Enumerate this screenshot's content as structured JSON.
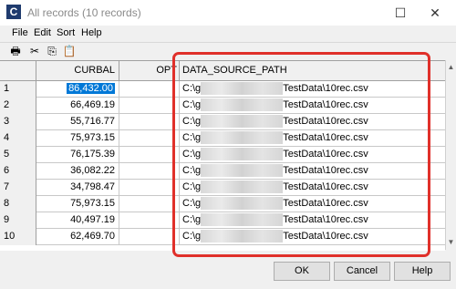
{
  "window": {
    "title": "All records (10 records)",
    "icon": "C",
    "max_glyph": "☐",
    "close_glyph": "✕"
  },
  "menu": {
    "file": "File",
    "edit": "Edit",
    "sort": "Sort",
    "help": "Help"
  },
  "toolbar": {
    "print": "🖶",
    "cut": "✂",
    "copy": "⎘",
    "paste": "📋"
  },
  "columns": {
    "curbal": "CURBAL",
    "opt": "OPT",
    "data_source_path": "DATA_SOURCE_PATH"
  },
  "rows": [
    {
      "num": "1",
      "curbal": "86,432.00",
      "path_prefix": "C:\\g",
      "path_suffix": "TestData\\10rec.csv"
    },
    {
      "num": "2",
      "curbal": "66,469.19",
      "path_prefix": "C:\\g",
      "path_suffix": "TestData\\10rec.csv"
    },
    {
      "num": "3",
      "curbal": "55,716.77",
      "path_prefix": "C:\\g",
      "path_suffix": "TestData\\10rec.csv"
    },
    {
      "num": "4",
      "curbal": "75,973.15",
      "path_prefix": "C:\\g",
      "path_suffix": "TestData\\10rec.csv"
    },
    {
      "num": "5",
      "curbal": "76,175.39",
      "path_prefix": "C:\\g",
      "path_suffix": "TestData\\10rec.csv"
    },
    {
      "num": "6",
      "curbal": "36,082.22",
      "path_prefix": "C:\\g",
      "path_suffix": "TestData\\10rec.csv"
    },
    {
      "num": "7",
      "curbal": "34,798.47",
      "path_prefix": "C:\\g",
      "path_suffix": "TestData\\10rec.csv"
    },
    {
      "num": "8",
      "curbal": "75,973.15",
      "path_prefix": "C:\\g",
      "path_suffix": "TestData\\10rec.csv"
    },
    {
      "num": "9",
      "curbal": "40,497.19",
      "path_prefix": "C:\\g",
      "path_suffix": "TestData\\10rec.csv"
    },
    {
      "num": "10",
      "curbal": "62,469.70",
      "path_prefix": "C:\\g",
      "path_suffix": "TestData\\10rec.csv"
    }
  ],
  "buttons": {
    "ok": "OK",
    "cancel": "Cancel",
    "help": "Help"
  },
  "scrollbar": {
    "up": "▲",
    "down": "▼"
  },
  "colors": {
    "highlight": "#e0302a",
    "selection": "#0078d7"
  }
}
